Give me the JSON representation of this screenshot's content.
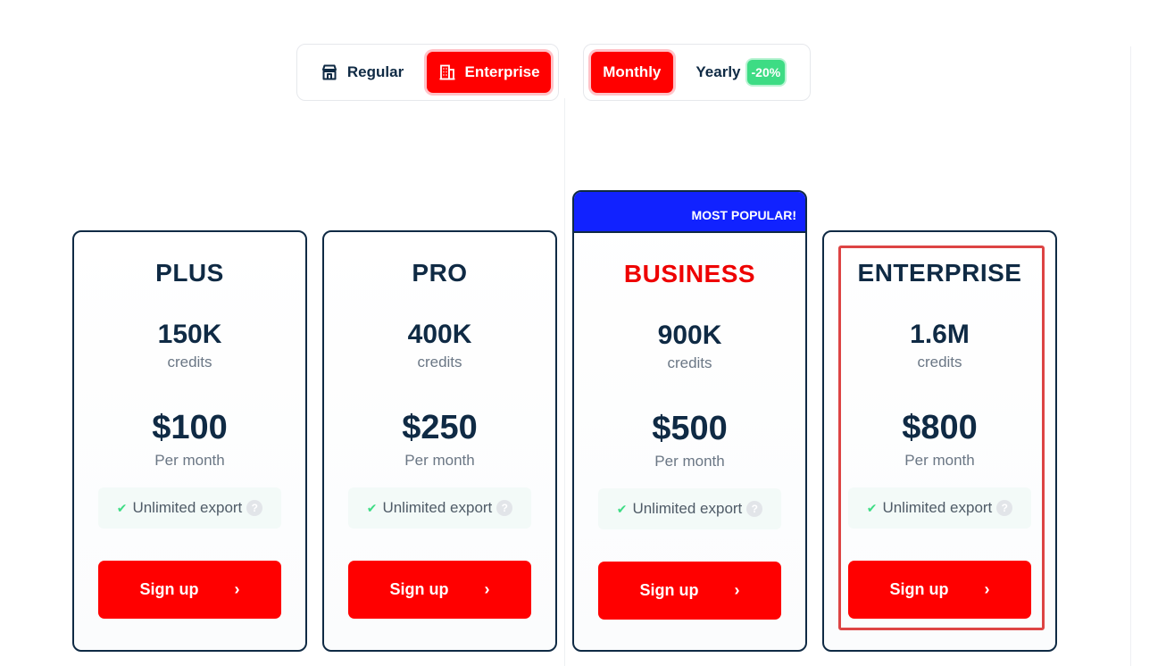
{
  "plan_type_toggle": {
    "regular_label": "Regular",
    "enterprise_label": "Enterprise",
    "selected": "Enterprise"
  },
  "billing_toggle": {
    "monthly_label": "Monthly",
    "yearly_label": "Yearly",
    "yearly_badge": "-20%",
    "selected": "Monthly"
  },
  "colors": {
    "accent": "#ff0000",
    "popular_banner": "#1122ff",
    "text_dark": "#0f2a44",
    "badge_green": "#3ddc84",
    "selection_outline": "#dd4444"
  },
  "plans": [
    {
      "name": "PLUS",
      "credits": "150K",
      "credits_label": "credits",
      "price": "$100",
      "period": "Per month",
      "feature": "Unlimited export",
      "cta": "Sign up"
    },
    {
      "name": "PRO",
      "credits": "400K",
      "credits_label": "credits",
      "price": "$250",
      "period": "Per month",
      "feature": "Unlimited export",
      "cta": "Sign up"
    },
    {
      "name": "BUSINESS",
      "credits": "900K",
      "credits_label": "credits",
      "price": "$500",
      "period": "Per month",
      "feature": "Unlimited export",
      "cta": "Sign up",
      "banner": "MOST POPULAR!"
    },
    {
      "name": "ENTERPRISE",
      "credits": "1.6M",
      "credits_label": "credits",
      "price": "$800",
      "period": "Per month",
      "feature": "Unlimited export",
      "cta": "Sign up"
    }
  ],
  "icons": {
    "regular": "store-icon",
    "enterprise": "building-icon",
    "feature": "check-icon",
    "help": "help-circle-icon",
    "cta": "chevron-right-icon"
  }
}
